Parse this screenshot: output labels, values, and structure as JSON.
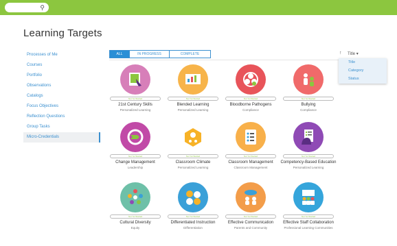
{
  "search": {
    "placeholder": "",
    "icon": "search-icon"
  },
  "page_title": "Learning Targets",
  "sidebar": {
    "items": [
      {
        "label": "Processes of Me"
      },
      {
        "label": "Courses"
      },
      {
        "label": "Portfolio"
      },
      {
        "label": "Observations"
      },
      {
        "label": "Catalogs"
      },
      {
        "label": "Focus Objectives"
      },
      {
        "label": "Reflection Questions"
      },
      {
        "label": "Group Tasks"
      },
      {
        "label": "Micro-Credentials",
        "active": true
      }
    ]
  },
  "filters": {
    "all": "ALL",
    "in_progress": "IN PROGRESS",
    "complete": "COMPLETE"
  },
  "sort": {
    "arrow": "↑",
    "label": "Title ▾",
    "options": [
      "Title",
      "Category",
      "Status"
    ]
  },
  "badge_text": "Not Yet Started",
  "cards": [
    {
      "title": "21st Century Skills",
      "sub": "Personalized Learning",
      "color": "#d77fb9",
      "icon": "touchscreen-icon"
    },
    {
      "title": "Blended Learning",
      "sub": "Personalized Learning",
      "color": "#f7b44a",
      "icon": "chart-board-icon"
    },
    {
      "title": "Bloodborne Pathogens",
      "sub": "Compliance",
      "color": "#e8545a",
      "icon": "biohazard-icon"
    },
    {
      "title": "Bullying",
      "sub": "Compliance",
      "color": "#f06a6a",
      "icon": "people-conflict-icon"
    },
    {
      "title": "Change Management",
      "sub": "Leadership",
      "color": "#c14aa7",
      "icon": "cycle-arrows-icon"
    },
    {
      "title": "Classroom Climate",
      "sub": "Personalized Learning",
      "color": "#f7b227",
      "icon": "sun-hexagon-icon"
    },
    {
      "title": "Classroom Management",
      "sub": "Classroom Management",
      "color": "#f8b04a",
      "icon": "checklist-icon"
    },
    {
      "title": "Competency-Based Education",
      "sub": "Personalized Learning",
      "color": "#8f4ab5",
      "icon": "head-checklist-icon"
    },
    {
      "title": "Cultural Diversity",
      "sub": "Equity",
      "color": "#6ec0a8",
      "icon": "diverse-people-icon"
    },
    {
      "title": "Differentiated Instruction",
      "sub": "Differentiation",
      "color": "#3aa0d8",
      "icon": "heads-icon"
    },
    {
      "title": "Effective Communication",
      "sub": "Parents and Community",
      "color": "#f39d4a",
      "icon": "speech-people-icon"
    },
    {
      "title": "Effective Staff Collaboration",
      "sub": "Professional Learning Communities",
      "color": "#35a5db",
      "icon": "team-board-icon"
    }
  ]
}
